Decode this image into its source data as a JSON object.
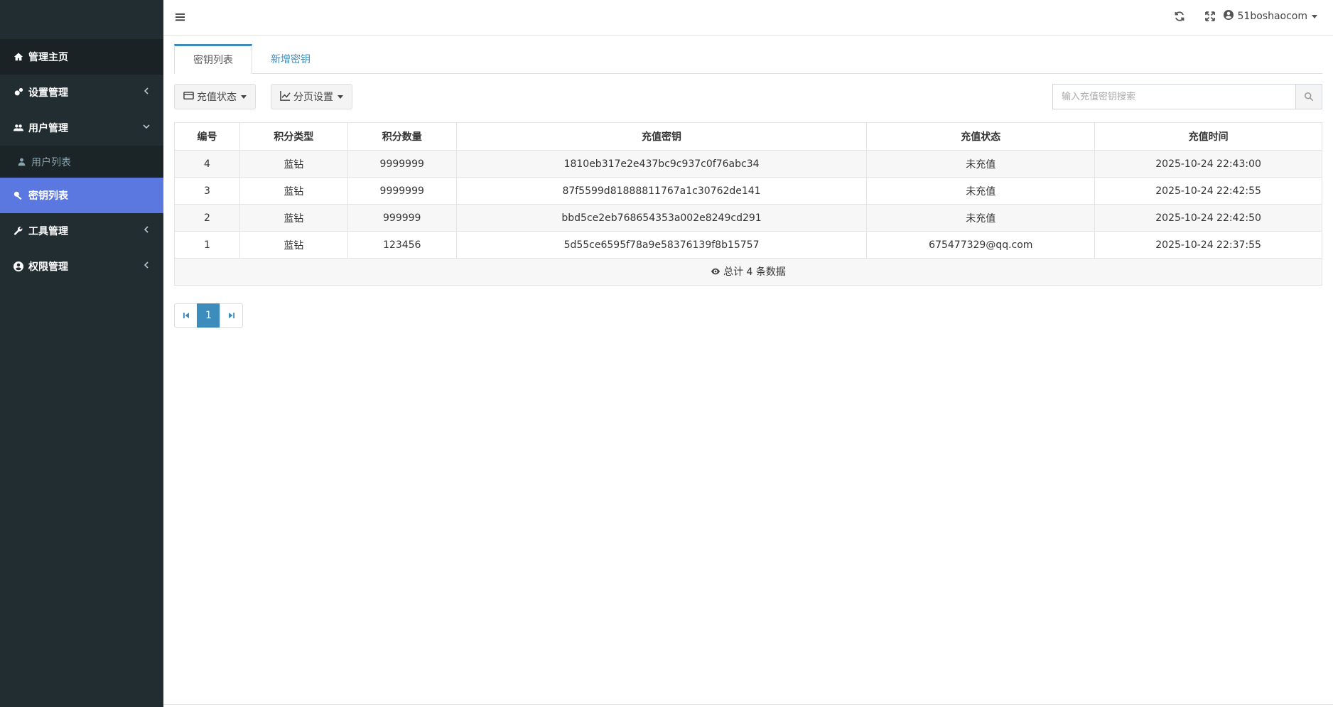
{
  "sidebar": {
    "items": [
      {
        "label": "管理主页",
        "icon": "home-icon"
      },
      {
        "label": "设置管理",
        "icon": "cogs-icon"
      },
      {
        "label": "用户管理",
        "icon": "users-icon"
      },
      {
        "label": "用户列表",
        "icon": "user-icon"
      },
      {
        "label": "密钥列表",
        "icon": "key-icon"
      },
      {
        "label": "工具管理",
        "icon": "wrench-icon"
      },
      {
        "label": "权限管理",
        "icon": "user-circle-icon"
      }
    ],
    "active_color": "#5b78e0"
  },
  "topbar": {
    "username": "51boshaocom"
  },
  "tabs": [
    {
      "label": "密钥列表"
    },
    {
      "label": "新增密钥"
    }
  ],
  "toolbar": {
    "status_label": "充值状态",
    "pagination_label": "分页设置",
    "search_placeholder": "输入充值密钥搜索"
  },
  "table": {
    "headers": [
      "编号",
      "积分类型",
      "积分数量",
      "充值密钥",
      "充值状态",
      "充值时间"
    ],
    "rows": [
      [
        "4",
        "蓝钻",
        "9999999",
        "1810eb317e2e437bc9c937c0f76abc34",
        "未充值",
        "2025-10-24 22:43:00"
      ],
      [
        "3",
        "蓝钻",
        "9999999",
        "87f5599d81888811767a1c30762de141",
        "未充值",
        "2025-10-24 22:42:55"
      ],
      [
        "2",
        "蓝钻",
        "999999",
        "bbd5ce2eb768654353a002e8249cd291",
        "未充值",
        "2025-10-24 22:42:50"
      ],
      [
        "1",
        "蓝钻",
        "123456",
        "5d55ce6595f78a9e58376139f8b15757",
        "675477329@qq.com",
        "2025-10-24 22:37:55"
      ]
    ],
    "footer": "总计 4 条数据"
  },
  "pagination": {
    "current": "1"
  },
  "colors": {
    "sidebar_bg": "#222d32",
    "accent": "#3c8dbc"
  }
}
